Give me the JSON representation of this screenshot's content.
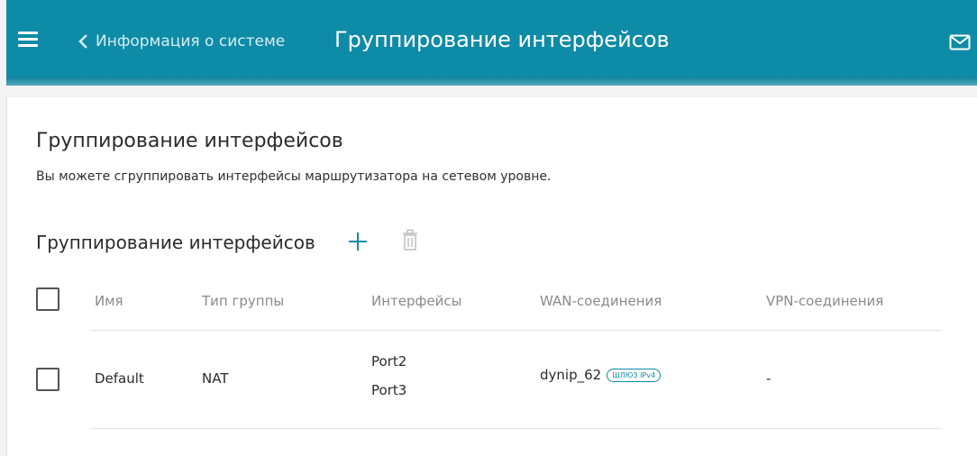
{
  "header": {
    "back_label": "Информация о системе",
    "title": "Группирование интерфейсов"
  },
  "main": {
    "title": "Группирование интерфейсов",
    "description": "Вы можете сгруппировать интерфейсы маршрутизатора на сетевом уровне.",
    "section_title": "Группирование интерфейсов"
  },
  "table": {
    "columns": [
      "Имя",
      "Тип группы",
      "Интерфейсы",
      "WAN-соединения",
      "VPN-соединения"
    ],
    "rows": [
      {
        "name": "Default",
        "group_type": "NAT",
        "interfaces": [
          "Port2",
          "Port3"
        ],
        "wan": "dynip_62",
        "wan_badge": "ШЛЮЗ IPv4",
        "vpn": "-"
      }
    ]
  },
  "icons": {
    "menu": "hamburger-icon",
    "back": "chevron-left-icon",
    "mail": "mail-icon",
    "add": "plus-icon",
    "delete": "trash-icon"
  },
  "colors": {
    "header_bg": "#0e8ba6",
    "accent": "#0e8ba6"
  }
}
